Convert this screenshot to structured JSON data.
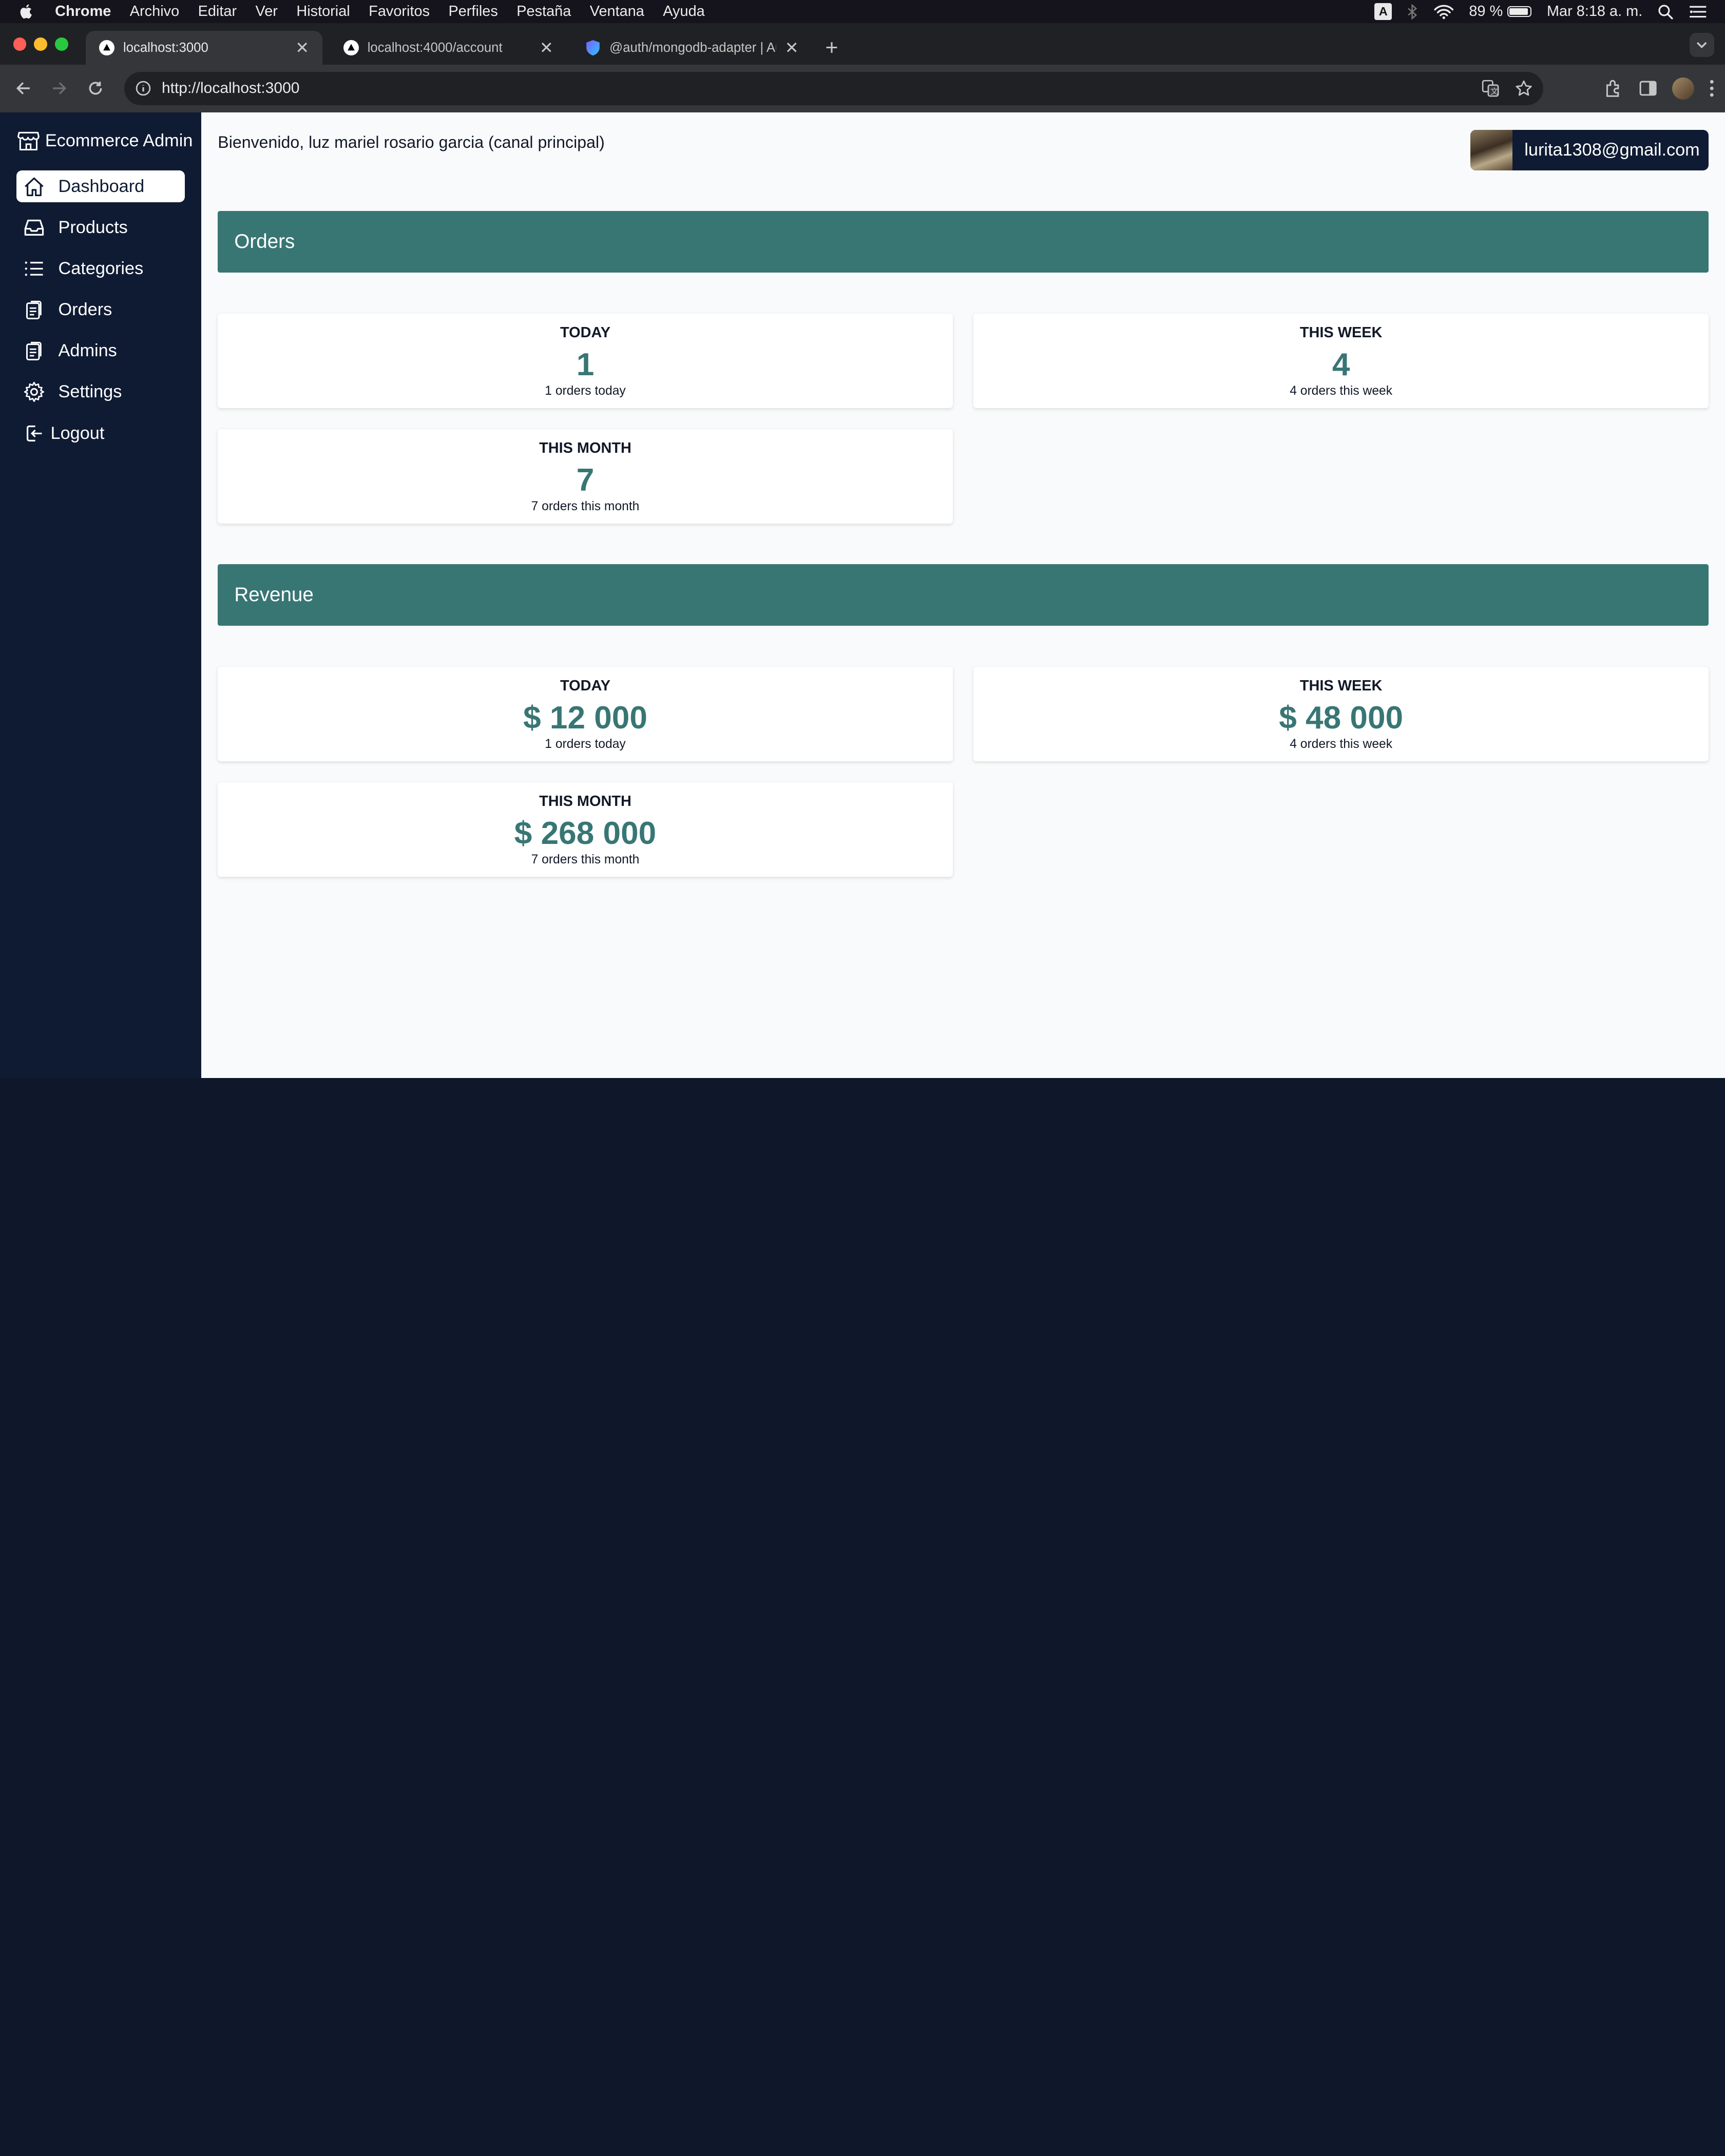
{
  "menubar": {
    "app_name": "Chrome",
    "items": [
      "Archivo",
      "Editar",
      "Ver",
      "Historial",
      "Favoritos",
      "Perfiles",
      "Pestaña",
      "Ventana",
      "Ayuda"
    ],
    "input_badge": "A",
    "battery": "89 %",
    "datetime": "Mar 8:18 a. m."
  },
  "browser": {
    "tabs": [
      {
        "title": "localhost:3000",
        "active": true
      },
      {
        "title": "localhost:4000/account",
        "active": false
      },
      {
        "title": "@auth/mongodb-adapter | Au",
        "active": false
      }
    ],
    "url": "http://localhost:3000"
  },
  "sidebar": {
    "brand": "Ecommerce Admin",
    "items": [
      {
        "label": "Dashboard",
        "icon": "home-icon",
        "active": true
      },
      {
        "label": "Products",
        "icon": "inbox-icon",
        "active": false
      },
      {
        "label": "Categories",
        "icon": "list-icon",
        "active": false
      },
      {
        "label": "Orders",
        "icon": "clipboard-icon",
        "active": false
      },
      {
        "label": "Admins",
        "icon": "clipboard-icon",
        "active": false
      },
      {
        "label": "Settings",
        "icon": "gear-icon",
        "active": false
      },
      {
        "label": "Logout",
        "icon": "logout-icon",
        "active": false
      }
    ]
  },
  "header": {
    "welcome": "Bienvenido, luz mariel rosario garcia (canal principal)",
    "email": "lurita1308@gmail.com"
  },
  "orders": {
    "title": "Orders",
    "today": {
      "label": "TODAY",
      "value": "1",
      "desc": "1 orders today"
    },
    "week": {
      "label": "THIS WEEK",
      "value": "4",
      "desc": "4 orders this week"
    },
    "month": {
      "label": "THIS MONTH",
      "value": "7",
      "desc": "7 orders this month"
    }
  },
  "revenue": {
    "title": "Revenue",
    "today": {
      "label": "TODAY",
      "value": "$ 12 000",
      "desc": "1 orders today"
    },
    "week": {
      "label": "THIS WEEK",
      "value": "$ 48 000",
      "desc": "4 orders this week"
    },
    "month": {
      "label": "THIS MONTH",
      "value": "$ 268 000",
      "desc": "7 orders this month"
    }
  },
  "colors": {
    "sidebar_bg": "#0f1b33",
    "accent_teal": "#387674",
    "page_bg": "#f9fafb"
  }
}
